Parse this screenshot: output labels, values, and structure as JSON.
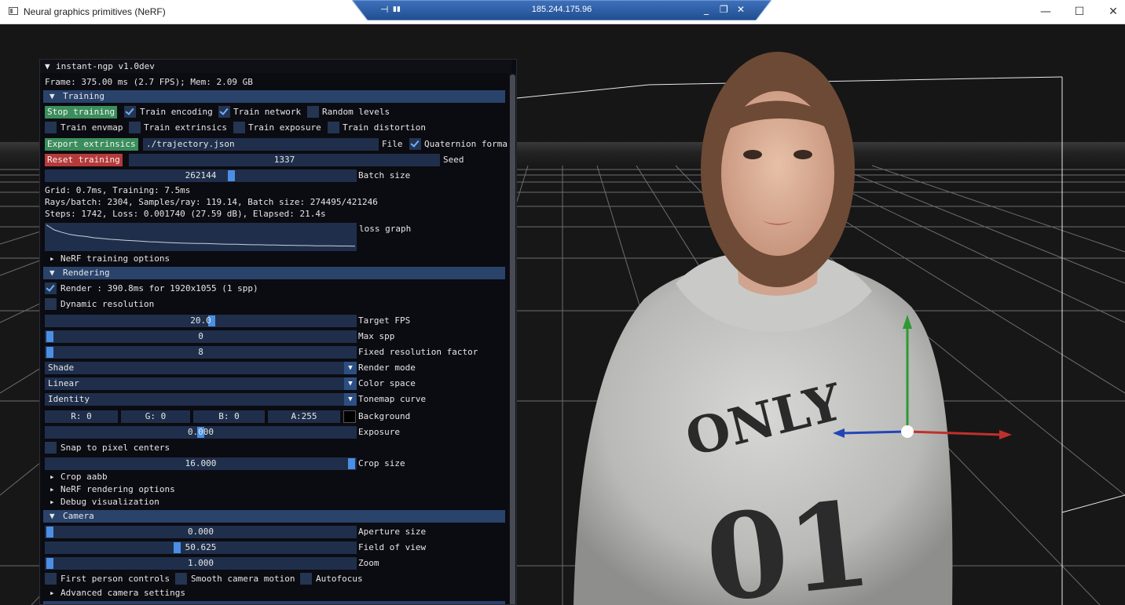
{
  "window": {
    "title": "Neural graphics primitives (NeRF)",
    "minimize": "—",
    "maximize": "☐",
    "close": "✕"
  },
  "remote": {
    "ip": "185.244.175.96",
    "pin": "⊣",
    "signal": "▮▮",
    "minimize": "_",
    "restore": "❐",
    "close": "✕"
  },
  "gui": {
    "title_arrow": "▼",
    "title": "instant-ngp v1.0dev",
    "frame_info": "Frame: 375.00 ms (2.7 FPS); Mem: 2.09 GB",
    "training": {
      "header_arrow": "▼",
      "header": "Training",
      "stop_training": "Stop training",
      "train_encoding": "Train encoding",
      "train_network": "Train network",
      "random_levels": "Random levels",
      "train_envmap": "Train envmap",
      "train_extrinsics": "Train extrinsics",
      "train_exposure": "Train exposure",
      "train_distortion": "Train distortion",
      "export_extrinsics": "Export extrinsics",
      "trajectory_file": "./trajectory.json",
      "file_label": "File",
      "quaternion_format": "Quaternion forma",
      "reset_training": "Reset training",
      "seed_value": "1337",
      "seed_label": "Seed",
      "batch_size_value": "262144",
      "batch_size_label": "Batch size",
      "timings": "Grid: 0.7ms, Training: 7.5ms",
      "rays": "Rays/batch: 2304, Samples/ray: 119.14, Batch size: 274495/421246",
      "steps": "Steps: 1742, Loss: 0.001740 (27.59 dB), Elapsed: 21.4s",
      "loss_graph_label": "loss graph",
      "loss_points": [
        0.98,
        0.78,
        0.68,
        0.6,
        0.55,
        0.52,
        0.47,
        0.44,
        0.41,
        0.39,
        0.37,
        0.35,
        0.33,
        0.31,
        0.3,
        0.28,
        0.27,
        0.26,
        0.25,
        0.24,
        0.24,
        0.23,
        0.22,
        0.21,
        0.21,
        0.2,
        0.19,
        0.19,
        0.18,
        0.18,
        0.17,
        0.17,
        0.16,
        0.16,
        0.15,
        0.15,
        0.15,
        0.14,
        0.14,
        0.13
      ],
      "nerf_training_options_arrow": "▸",
      "nerf_training_options": "NeRF training options"
    },
    "rendering": {
      "header_arrow": "▼",
      "header": "Rendering",
      "render_label": "Render : 390.8ms for 1920x1055 (1 spp)",
      "dynamic_resolution": "Dynamic resolution",
      "target_fps_value": "20.0",
      "target_fps_label": "Target FPS",
      "max_spp_value": "0",
      "max_spp_label": "Max spp",
      "fixed_res_value": "8",
      "fixed_res_label": "Fixed resolution factor",
      "render_mode_value": "Shade",
      "render_mode_label": "Render mode",
      "color_space_value": "Linear",
      "color_space_label": "Color space",
      "tonemap_value": "Identity",
      "tonemap_label": "Tonemap curve",
      "dropdown_glyph": "▼",
      "bg_r": "R:  0",
      "bg_g": "G:  0",
      "bg_b": "B:  0",
      "bg_a": "A:255",
      "background_label": "Background",
      "background_color": "#000000",
      "exposure_value": "0.000",
      "exposure_label": "Exposure",
      "snap_to_pixel": "Snap to pixel centers",
      "crop_size_value": "16.000",
      "crop_size_label": "Crop size",
      "crop_aabb_arrow": "▸",
      "crop_aabb": "Crop aabb",
      "nerf_rendering_options_arrow": "▸",
      "nerf_rendering_options": "NeRF rendering options",
      "debug_visualization_arrow": "▸",
      "debug_visualization": "Debug visualization"
    },
    "camera": {
      "header_arrow": "▼",
      "header": "Camera",
      "aperture_value": "0.000",
      "aperture_label": "Aperture size",
      "fov_value": "50.625",
      "fov_label": "Field of view",
      "zoom_value": "1.000",
      "zoom_label": "Zoom",
      "first_person": "First person controls",
      "smooth_motion": "Smooth camera motion",
      "autofocus": "Autofocus",
      "advanced_arrow": "▸",
      "advanced": "Advanced camera settings"
    }
  },
  "scene": {
    "hoodie_text_line1": "ONLY",
    "hoodie_text_line2": "01",
    "gizmo_colors": {
      "x": "#c0302b",
      "y": "#2e9a33",
      "z": "#2444b8"
    }
  }
}
